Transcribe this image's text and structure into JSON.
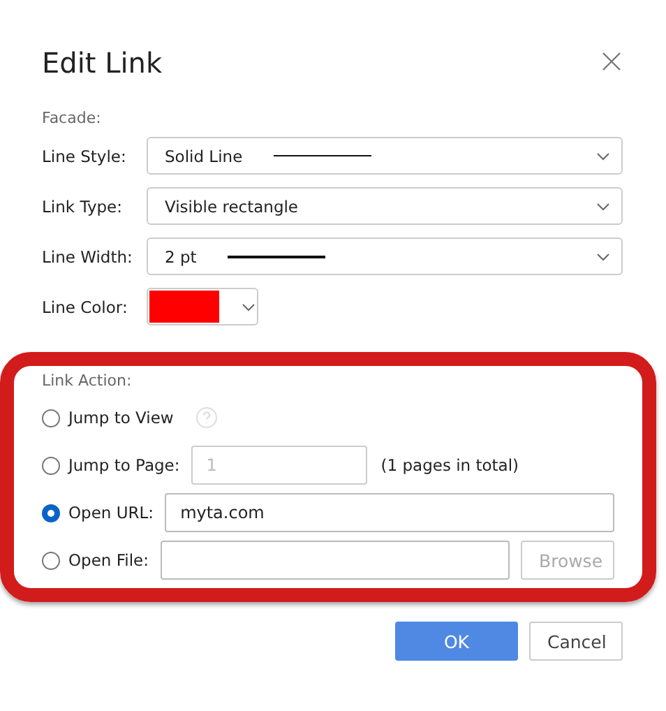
{
  "dialog": {
    "title": "Edit Link"
  },
  "facade": {
    "label": "Facade:",
    "fields": [
      {
        "kind": "thinline",
        "label": "Line Style:",
        "value": "Solid Line"
      },
      {
        "kind": "select",
        "label": "Link Type:",
        "value": "Visible rectangle"
      },
      {
        "kind": "thickline",
        "label": "Line Width:",
        "value": "2 pt"
      },
      {
        "kind": "color",
        "label": "Line Color:",
        "color": "#ff0000"
      }
    ]
  },
  "link_action": {
    "label": "Link Action:",
    "highlighted": true,
    "options": [
      {
        "kind": "help",
        "label": "Jump to View",
        "selected": false
      },
      {
        "kind": "page",
        "label": "Jump to Page:",
        "selected": false,
        "field": {
          "placeholder": "1",
          "disabled": true
        },
        "note": "(1 pages in total)"
      },
      {
        "kind": "url",
        "label": "Open URL:",
        "selected": true,
        "field": {
          "value": "myta.com"
        }
      },
      {
        "kind": "file",
        "label": "Open File:",
        "selected": false,
        "button": {
          "label": "Browse",
          "disabled": true
        }
      }
    ]
  },
  "buttons": [
    {
      "kind": "primary",
      "label": "OK"
    },
    {
      "kind": "secondary",
      "label": "Cancel"
    }
  ]
}
